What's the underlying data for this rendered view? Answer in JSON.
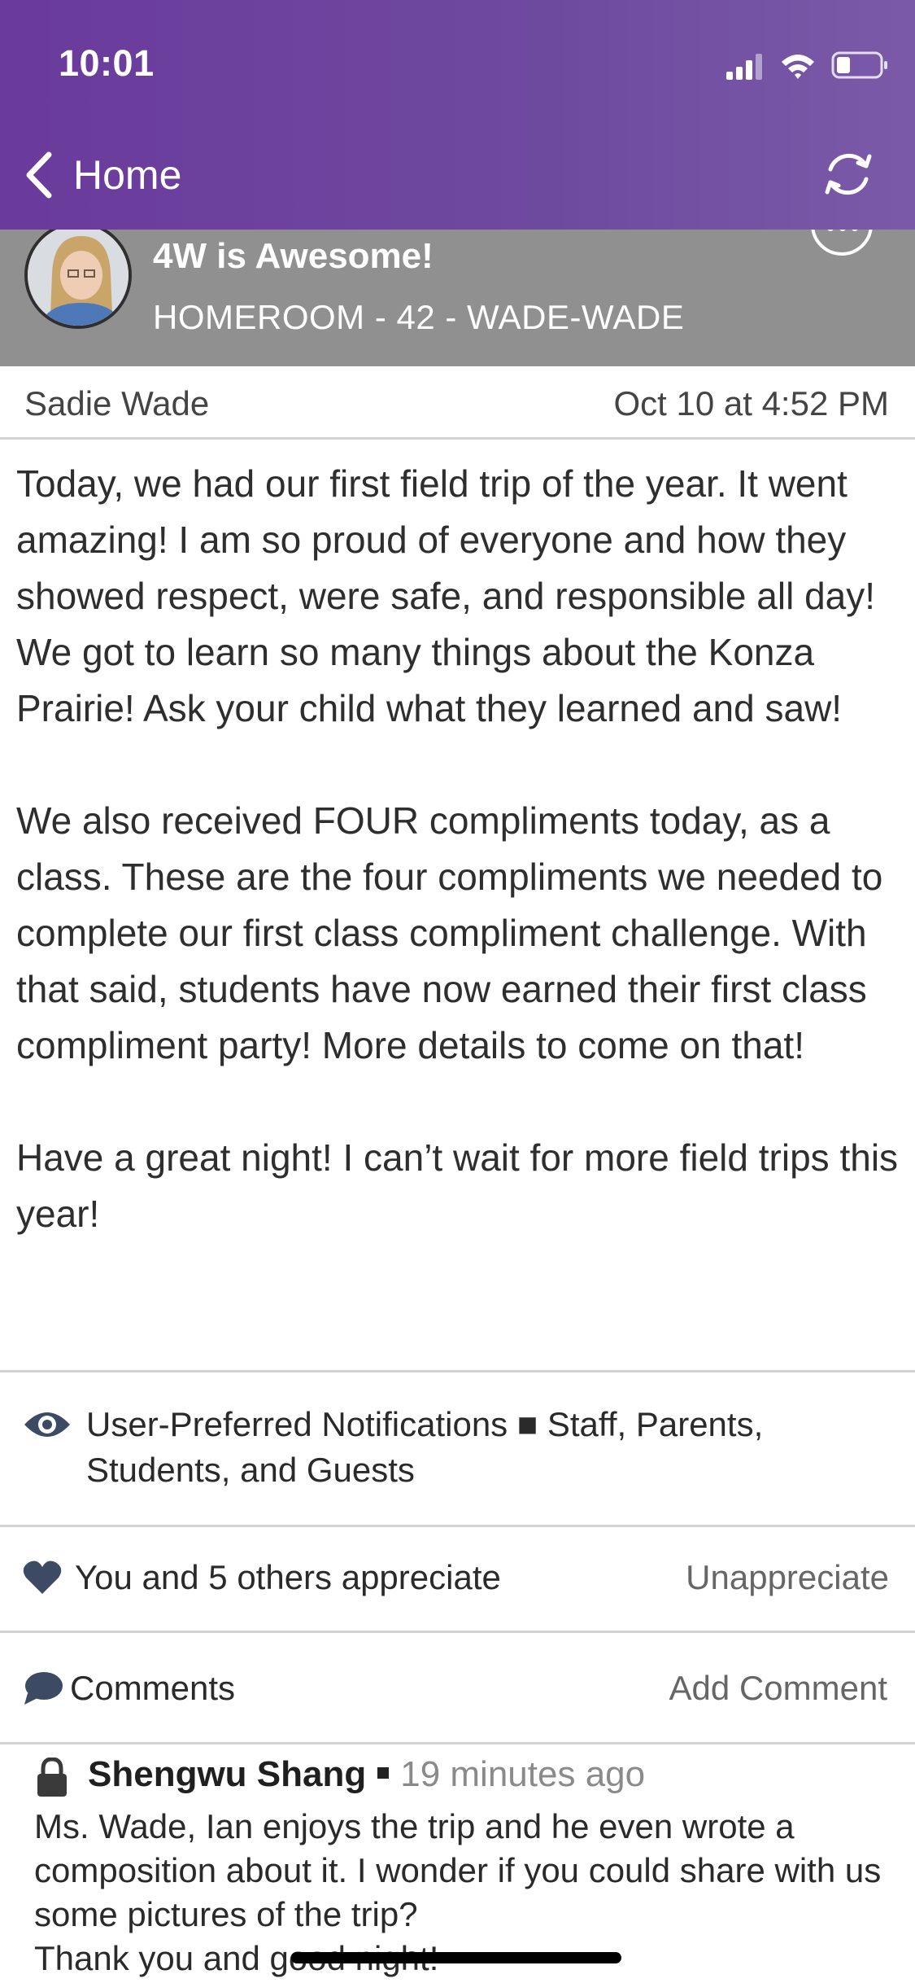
{
  "status_bar": {
    "time": "10:01",
    "icons": [
      "cellular-signal-icon",
      "wifi-icon",
      "battery-icon"
    ]
  },
  "nav": {
    "back_label": "Home",
    "refresh_icon": "refresh-icon"
  },
  "group": {
    "title": "4W is Awesome!",
    "subtitle": "HOMEROOM - 42 - WADE-WADE"
  },
  "post": {
    "author": "Sadie Wade",
    "date": "Oct 10 at 4:52 PM",
    "paragraphs": [
      "Today, we had our first field trip of the year. It went amazing! I am so proud of everyone and how they showed respect, were safe, and responsible all day! We got to learn so many things about the Konza Prairie! Ask your child what they learned and saw!",
      "We also received FOUR compliments today, as a class. These are the four compliments we needed to complete our first class compliment challenge. With that said, students have now earned their first class compliment party! More details to come on that!",
      "Have a great night! I can’t wait for more field trips this year!"
    ],
    "visibility": "User-Preferred Notifications ■ Staff, Parents, Students, and Guests",
    "appreciate_text": "You and 5 others appreciate",
    "unappreciate_label": "Unappreciate"
  },
  "comments": {
    "label": "Comments",
    "add_label": "Add Comment",
    "items": [
      {
        "author": "Shengwu Shang",
        "time": "19 minutes ago",
        "text": "Ms. Wade, Ian enjoys the trip and he even wrote a composition about it. I wonder if you could share with us some pictures of the trip?\nThank you and good night!"
      }
    ]
  },
  "colors": {
    "header_purple": "#6a3a9c",
    "banner_gray": "#909090",
    "icon_slate": "#3d4a63"
  }
}
